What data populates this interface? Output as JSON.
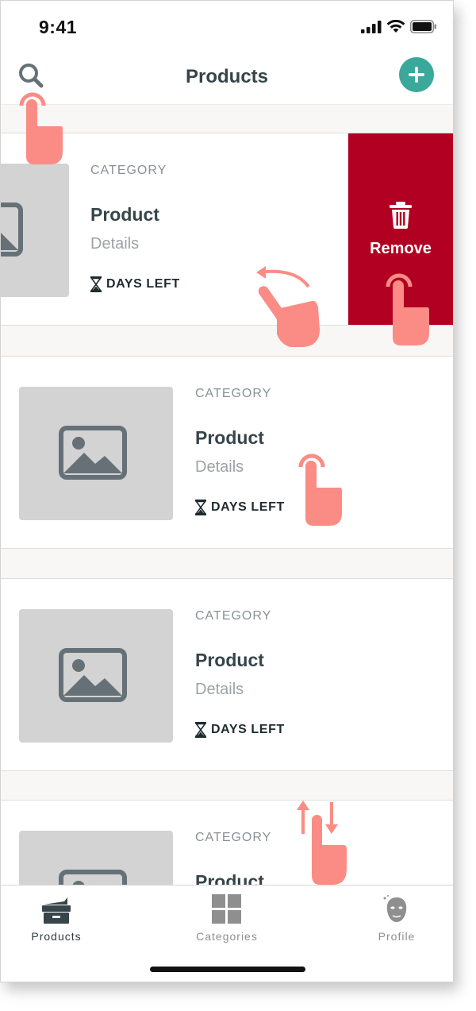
{
  "status_bar": {
    "time": "9:41"
  },
  "header": {
    "title": "Products"
  },
  "product_cards": [
    {
      "category": "CATEGORY",
      "name": "Product",
      "details": "Details",
      "days_left": "DAYS LEFT",
      "swiped": true
    },
    {
      "category": "CATEGORY",
      "name": "Product",
      "details": "Details",
      "days_left": "DAYS LEFT",
      "swiped": false
    },
    {
      "category": "CATEGORY",
      "name": "Product",
      "details": "Details",
      "days_left": "DAYS LEFT",
      "swiped": false
    },
    {
      "category": "CATEGORY",
      "name": "Product",
      "details": "",
      "days_left": "",
      "swiped": false
    }
  ],
  "swipe_action": {
    "label": "Remove",
    "color": "#b10022"
  },
  "tab_bar": {
    "tabs": [
      {
        "label": "Products",
        "icon": "products-box-icon",
        "active": true
      },
      {
        "label": "Categories",
        "icon": "grid-icon",
        "active": false
      },
      {
        "label": "Profile",
        "icon": "face-mask-icon",
        "active": false
      }
    ]
  },
  "colors": {
    "accent": "#3aa99b",
    "title": "#35454a",
    "remove": "#b10022",
    "gesture": "#fa8c85"
  },
  "gestures": [
    {
      "type": "tap",
      "target": "search-button",
      "icon": "tap-hand-icon"
    },
    {
      "type": "swipe-left",
      "target": "product-card-1",
      "icon": "swipe-hand-icon"
    },
    {
      "type": "tap",
      "target": "remove-button",
      "icon": "tap-hand-icon"
    },
    {
      "type": "tap",
      "target": "product-card-2",
      "icon": "tap-hand-icon"
    },
    {
      "type": "scroll-vertical",
      "target": "product-list",
      "icon": "scroll-hand-icon"
    }
  ]
}
